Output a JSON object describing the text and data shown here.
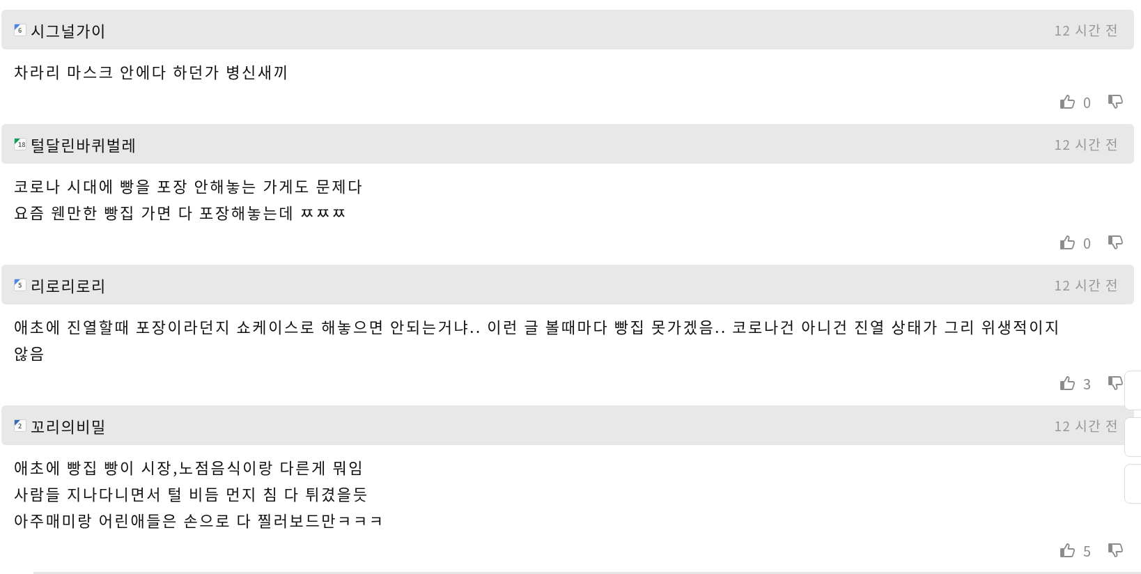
{
  "comments": [
    {
      "level": "6",
      "color": "#4a86e8",
      "author": "시그널가이",
      "time": "12 시간 전",
      "lines": [
        "차라리 마스크 안에다 하던가 병신새끼"
      ],
      "likes": "0"
    },
    {
      "level": "18",
      "color": "#0f9d58",
      "author": "털달린바퀴벌레",
      "time": "12 시간 전",
      "lines": [
        "코로나 시대에 빵을 포장 안해놓는 가게도 문제다",
        "요즘 웬만한 빵집 가면 다 포장해놓는데 ㅉㅉㅉ"
      ],
      "likes": "0"
    },
    {
      "level": "5",
      "color": "#4a86e8",
      "author": "리로리로리",
      "time": "12 시간 전",
      "lines": [
        "애초에 진열할때 포장이라던지 쇼케이스로 해놓으면 안되는거냐.. 이런 글 볼때마다 빵집 못가겠음.. 코로나건 아니건 진열 상태가 그리 위생적이지 않음"
      ],
      "likes": "3"
    },
    {
      "level": "2",
      "color": "#3a6bb5",
      "author": "꼬리의비밀",
      "time": "12 시간 전",
      "lines": [
        "애초에 빵집 빵이 시장,노점음식이랑 다른게 뭐임",
        "사람들 지나다니면서 털 비듬 먼지 침 다 튀겼을듯",
        "아주매미랑 어린애들은 손으로 다 찔러보드만ㅋㅋㅋ"
      ],
      "likes": "5"
    }
  ]
}
